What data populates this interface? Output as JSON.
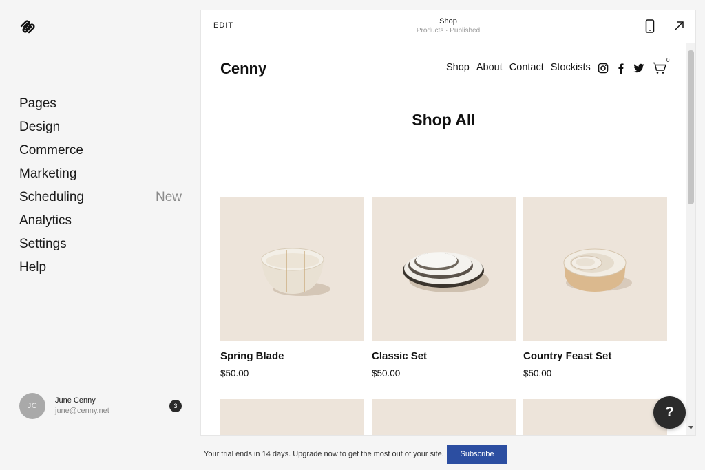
{
  "sidebar": {
    "items": [
      {
        "label": "Pages",
        "badge": ""
      },
      {
        "label": "Design",
        "badge": ""
      },
      {
        "label": "Commerce",
        "badge": ""
      },
      {
        "label": "Marketing",
        "badge": ""
      },
      {
        "label": "Scheduling",
        "badge": "New"
      },
      {
        "label": "Analytics",
        "badge": ""
      },
      {
        "label": "Settings",
        "badge": ""
      },
      {
        "label": "Help",
        "badge": ""
      }
    ],
    "user": {
      "initials": "JC",
      "name": "June Cenny",
      "email": "june@cenny.net",
      "notifications": "3"
    }
  },
  "topbar": {
    "edit_label": "EDIT",
    "title": "Shop",
    "subtitle": "Products · Published"
  },
  "site": {
    "logo": "Cenny",
    "nav": [
      "Shop",
      "About",
      "Contact",
      "Stockists"
    ],
    "active_nav": "Shop",
    "social_icons": [
      "instagram-icon",
      "facebook-icon",
      "twitter-icon"
    ],
    "cart_count": "0",
    "page_title": "Shop All",
    "products": [
      {
        "name": "Spring Blade",
        "price": "$50.00"
      },
      {
        "name": "Classic Set",
        "price": "$50.00"
      },
      {
        "name": "Country Feast Set",
        "price": "$50.00"
      }
    ]
  },
  "help": {
    "label": "?"
  },
  "trial": {
    "text": "Your trial ends in 14 days. Upgrade now to get the most out of your site.",
    "button": "Subscribe"
  },
  "colors": {
    "accent": "#2c4ea1",
    "product_bg": "#ede4da"
  }
}
